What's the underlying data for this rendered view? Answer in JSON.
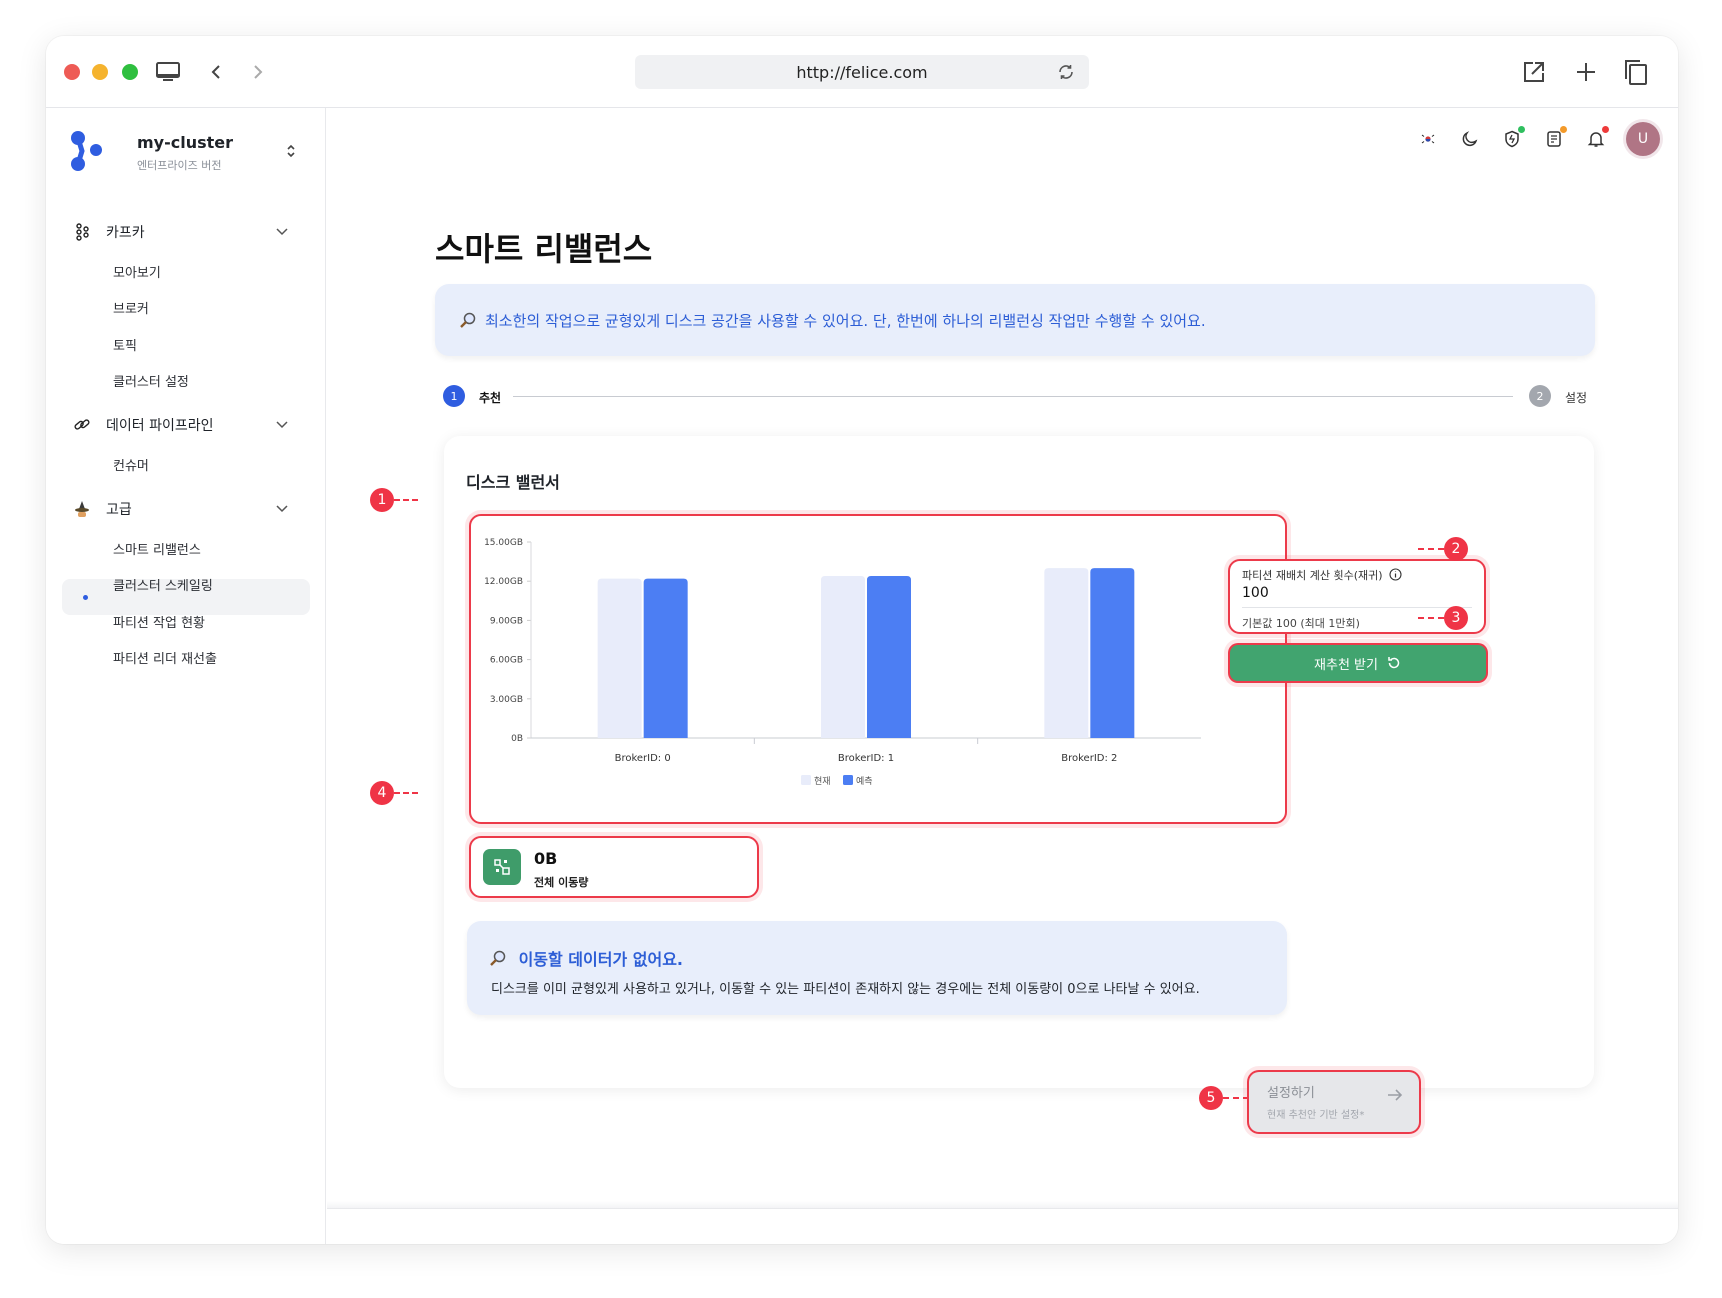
{
  "browser": {
    "url": "http://felice.com"
  },
  "sidebar": {
    "cluster_name": "my-cluster",
    "cluster_edition": "엔터프라이즈 버전",
    "groups": [
      {
        "label": "카프카",
        "icon": "kafka-icon",
        "items": [
          "모아보기",
          "브로커",
          "토픽",
          "클러스터 설정"
        ]
      },
      {
        "label": "데이터 파이프라인",
        "icon": "pipeline-link-icon",
        "items": [
          "컨슈머"
        ]
      },
      {
        "label": "고급",
        "icon": "wizard-icon",
        "items": [
          "스마트 리밸런스",
          "클러스터 스케일링",
          "파티션 작업 현황",
          "파티션 리더 재선출"
        ]
      }
    ],
    "active_item": "스마트 리밸런스"
  },
  "header": {
    "avatar_initial": "U",
    "icons": [
      "korea-flag-icon",
      "moon-icon",
      "shield-icon",
      "notes-icon",
      "bell-icon"
    ]
  },
  "page": {
    "title": "스마트 리밸런스",
    "info_banner": "최소한의 작업으로 균형있게 디스크 공간을 사용할 수 있어요. 단, 한번에 하나의 리밸런싱 작업만 수행할 수 있어요.",
    "steps": [
      {
        "number": "1",
        "label": "추천",
        "active": true
      },
      {
        "number": "2",
        "label": "설정",
        "active": false
      }
    ]
  },
  "balancer": {
    "title": "디스크 밸런서",
    "param_label": "파티션 재배치 계산 횟수(재귀)",
    "param_value": "100",
    "param_hint": "기본값 100 (최대 1만회)",
    "recommend_button": "재추천 받기",
    "total_move_value": "0B",
    "total_move_label": "전체 이동량",
    "empty_title": "이동할 데이터가 없어요.",
    "empty_desc": "디스크를 이미 균형있게 사용하고 있거나, 이동할 수 있는 파티션이 존재하지 않는 경우에는 전체 이동량이 0으로 나타날 수 있어요.",
    "annotations": [
      "1",
      "2",
      "3",
      "4",
      "5"
    ]
  },
  "footer": {
    "next_title": "설정하기",
    "next_sub": "현재 추천안 기반 설정*"
  },
  "colors": {
    "primary": "#4c7ef3",
    "current": "#e8ecfa",
    "green": "#41a46f",
    "highlight": "#ec3a4a",
    "banner_bg": "#e8eefb",
    "banner_text": "#2d5ed6"
  },
  "chart_data": {
    "type": "bar",
    "categories": [
      "BrokerID: 0",
      "BrokerID: 1",
      "BrokerID: 2"
    ],
    "series": [
      {
        "name": "현재",
        "values": [
          12.2,
          12.4,
          13.0
        ],
        "color": "#e8ecfa"
      },
      {
        "name": "예측",
        "values": [
          12.2,
          12.4,
          13.0
        ],
        "color": "#4c7ef3"
      }
    ],
    "y_ticks": [
      "0B",
      "3.00GB",
      "6.00GB",
      "9.00GB",
      "12.00GB",
      "15.00GB"
    ],
    "ylim": [
      0,
      15
    ],
    "legend": "bottom-center"
  }
}
